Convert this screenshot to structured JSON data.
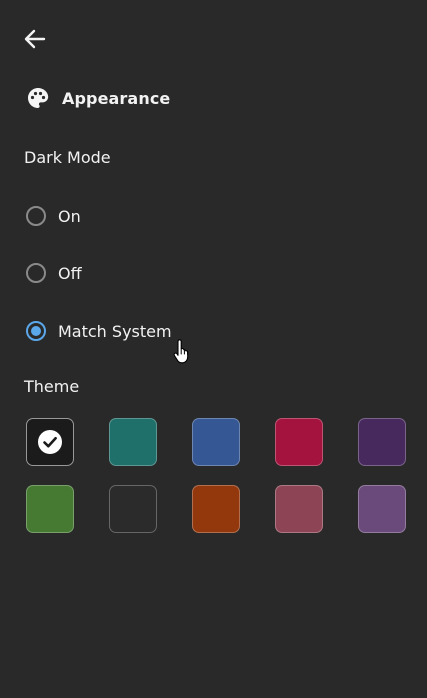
{
  "nav": {
    "back_icon": "arrow-left-icon"
  },
  "section": {
    "icon": "palette-icon",
    "title": "Appearance"
  },
  "dark_mode": {
    "label": "Dark Mode",
    "options": [
      {
        "label": "On",
        "selected": false
      },
      {
        "label": "Off",
        "selected": false
      },
      {
        "label": "Match System",
        "selected": true
      }
    ]
  },
  "theme": {
    "label": "Theme",
    "selected_index": 0,
    "swatches": [
      {
        "color": "#1b1b1b"
      },
      {
        "color": "#1f6f6a"
      },
      {
        "color": "#355794"
      },
      {
        "color": "#a3133e"
      },
      {
        "color": "#47295e"
      },
      {
        "color": "#467a33"
      },
      {
        "color": "#2b2b2b"
      },
      {
        "color": "#93380d"
      },
      {
        "color": "#8d4555"
      },
      {
        "color": "#6a4a7a"
      }
    ]
  },
  "colors": {
    "background": "#292929",
    "accent": "#5aa7ea",
    "text": "#f2f2f2"
  }
}
